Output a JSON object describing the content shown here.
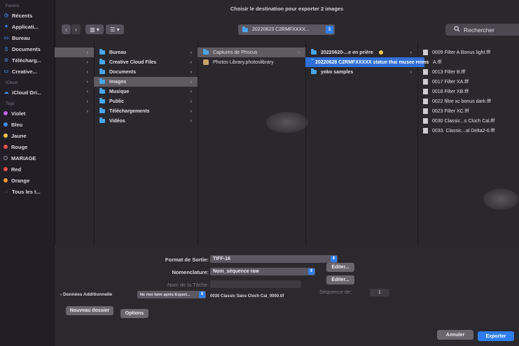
{
  "window": {
    "title": "Choisir le destination pour exporter 2 images"
  },
  "sidebar": {
    "favorites_header": "Favoris",
    "favorites": [
      {
        "label": "Récents",
        "icon": "clock-icon"
      },
      {
        "label": "Applicati...",
        "icon": "apps-icon"
      },
      {
        "label": "Bureau",
        "icon": "desktop-icon"
      },
      {
        "label": "Documents",
        "icon": "document-icon"
      },
      {
        "label": "Télécharg...",
        "icon": "download-icon"
      },
      {
        "label": "Creative...",
        "icon": "folder-icon"
      }
    ],
    "icloud_header": "iCloud",
    "icloud": [
      {
        "label": "iCloud Dri...",
        "icon": "cloud-icon"
      }
    ],
    "tags_header": "Tags",
    "tags": [
      {
        "label": "Violet",
        "color": "#c060e0"
      },
      {
        "label": "Bleu",
        "color": "#3d8ef0"
      },
      {
        "label": "Jaune",
        "color": "#f1c94a"
      },
      {
        "label": "Rouge",
        "color": "#e9504a"
      },
      {
        "label": "MARIAGE",
        "color": "none"
      },
      {
        "label": "Red",
        "color": "#e9504a"
      },
      {
        "label": "Orange",
        "color": "#f39a2b"
      },
      {
        "label": "Tous les t...",
        "color": "none"
      }
    ]
  },
  "toolbar": {
    "back_glyph": "‹",
    "forward_glyph": "›",
    "view_glyph": "▥ ▾",
    "group_glyph": "☰ ▾",
    "path_label": "20220623 C2RMFXXXX...",
    "search_placeholder": "Rechercher"
  },
  "columns": {
    "col1": [
      "",
      "",
      "",
      "",
      "",
      "",
      ""
    ],
    "col2": [
      "Bureau",
      "Creative Cloud Files",
      "Documents",
      "Images",
      "Musique",
      "Public",
      "Téléchargements",
      "Vidéos"
    ],
    "col3": [
      "Captures de Phocus",
      "Photos Library.photoslibrary"
    ],
    "col4": [
      "20220620-...e en prière",
      "20220628 C2RMFXXXXX statue thai  musee reims",
      "yoko samples"
    ],
    "col5": [
      "0009 Filter A Bonus light.fff",
      "A.fff",
      "0013 Filter B.fff",
      "0017 Filter XA.fff",
      "0018 Filter XB.fff",
      "0022 filtre xc bonus dark.fff",
      "0023 Filter XC.fff",
      "0030 Classic...s Cloch Cal.fff",
      "0033. Classic...al Delta2-6.fff"
    ]
  },
  "options": {
    "format_label": "Format de Sortie:",
    "format_value": "TIFF-16",
    "naming_label": "Nomenclature:",
    "naming_value": "Nom_séquence raw",
    "task_label": "Nom de la Tâche:",
    "edit_label": "Éditer...",
    "sequence_label": "Séquence de:",
    "sequence_value": "1",
    "additional_label": "Données Additionnelle",
    "after_export_value": "Ne rien faire après Export...",
    "example_filename": "0030 Classic Sans Cloch Cal_0000.tif",
    "new_folder": "Nouveau dossier",
    "options_button": "Options",
    "cancel": "Annuler",
    "export": "Exporter"
  }
}
